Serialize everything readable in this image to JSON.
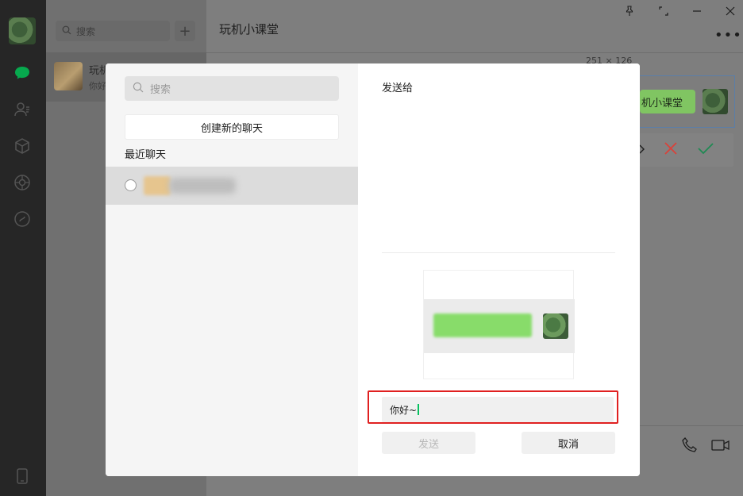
{
  "app": {
    "search_placeholder": "搜索",
    "add_label": "+",
    "chat_item": {
      "name": "玩机",
      "preview": "你好"
    },
    "chat_title": "玩机小课堂",
    "more_label": "•••",
    "bubble_text": "机小课堂",
    "number_hint": "251 × 126",
    "icons": [
      "chat-icon",
      "contacts-icon",
      "box-icon",
      "moments-icon",
      "channels-icon",
      "phone-icon"
    ]
  },
  "dialog": {
    "search_placeholder": "搜索",
    "new_chat_label": "创建新的聊天",
    "recent_label": "最近聊天",
    "send_to_label": "发送给",
    "message_value": "你好~",
    "send_label": "发送",
    "cancel_label": "取消"
  },
  "colors": {
    "accent": "#07c160",
    "highlight_outline": "#e02020"
  }
}
